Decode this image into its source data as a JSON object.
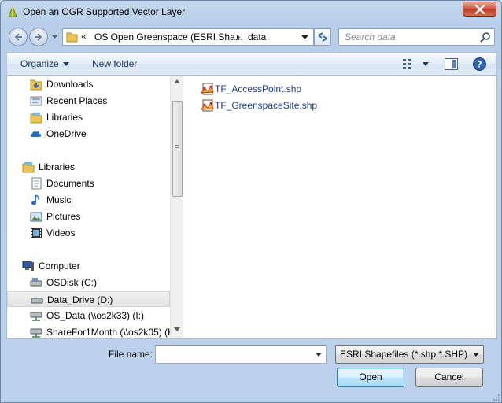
{
  "window": {
    "title": "Open an OGR Supported Vector Layer"
  },
  "address_bar": {
    "prefix": "«",
    "segments": [
      "OS Open Greenspace (ESRI Sha...",
      "data"
    ]
  },
  "search": {
    "placeholder": "Search data"
  },
  "command_bar": {
    "organize_label": "Organize",
    "new_folder_label": "New folder"
  },
  "nav_pane": {
    "items": [
      {
        "label": "Downloads",
        "icon": "downloads-folder-icon"
      },
      {
        "label": "Recent Places",
        "icon": "recent-places-icon"
      },
      {
        "label": "Libraries",
        "icon": "libraries-icon"
      },
      {
        "label": "OneDrive",
        "icon": "onedrive-icon"
      },
      {
        "label": "Libraries",
        "icon": "libraries-icon"
      },
      {
        "label": "Documents",
        "icon": "documents-icon"
      },
      {
        "label": "Music",
        "icon": "music-icon"
      },
      {
        "label": "Pictures",
        "icon": "pictures-icon"
      },
      {
        "label": "Videos",
        "icon": "videos-icon"
      },
      {
        "label": "Computer",
        "icon": "computer-icon"
      },
      {
        "label": "OSDisk (C:)",
        "icon": "hard-drive-icon"
      },
      {
        "label": "Data_Drive (D:)",
        "icon": "hard-drive-icon",
        "selected": true
      },
      {
        "label": "OS_Data (\\\\os2k33) (I:)",
        "icon": "network-drive-icon"
      },
      {
        "label": "ShareFor1Month (\\\\os2k05) (K",
        "icon": "network-drive-icon"
      }
    ]
  },
  "files": [
    {
      "name": "TF_AccessPoint.shp",
      "icon": "shapefile-icon"
    },
    {
      "name": "TF_GreenspaceSite.shp",
      "icon": "shapefile-icon"
    }
  ],
  "footer": {
    "file_name_label": "File name:",
    "file_name_value": "",
    "filter_value": "ESRI Shapefiles (*.shp *.SHP)",
    "open_label": "Open",
    "cancel_label": "Cancel"
  },
  "colors": {
    "link_text": "#1a3c8f",
    "command_text": "#1e3a5f",
    "selection": "#e3e3e3"
  }
}
